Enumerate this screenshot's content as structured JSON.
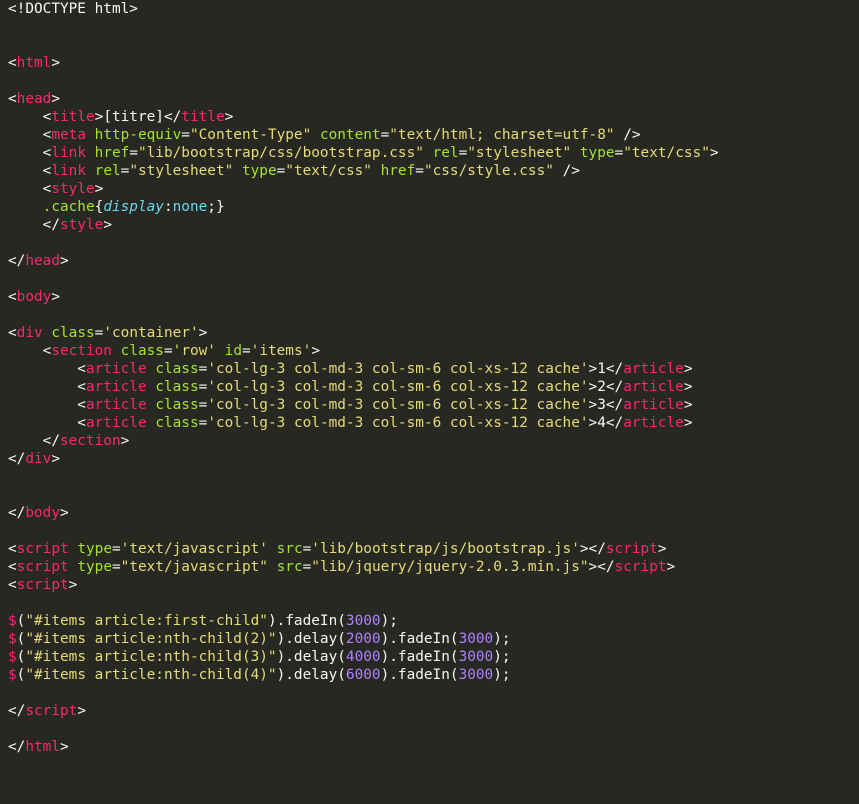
{
  "editor": {
    "theme": {
      "background": "#272822",
      "plain": "#f8f8f2",
      "tag": "#f92672",
      "attribute": "#a6e22e",
      "string": "#e6db74",
      "number": "#ae81ff",
      "property": "#66d9ef"
    },
    "lines": [
      [
        {
          "t": "<!DOCTYPE html>",
          "c": "plain"
        }
      ],
      [],
      [],
      [
        {
          "t": "<",
          "c": "plain"
        },
        {
          "t": "html",
          "c": "tag"
        },
        {
          "t": ">",
          "c": "plain"
        }
      ],
      [],
      [
        {
          "t": "<",
          "c": "plain"
        },
        {
          "t": "head",
          "c": "tag"
        },
        {
          "t": ">",
          "c": "plain"
        }
      ],
      [
        {
          "t": "    <",
          "c": "plain"
        },
        {
          "t": "title",
          "c": "tag"
        },
        {
          "t": ">[titre]</",
          "c": "plain"
        },
        {
          "t": "title",
          "c": "tag"
        },
        {
          "t": ">",
          "c": "plain"
        }
      ],
      [
        {
          "t": "    <",
          "c": "plain"
        },
        {
          "t": "meta",
          "c": "tag"
        },
        {
          "t": " ",
          "c": "plain"
        },
        {
          "t": "http-equiv",
          "c": "attr"
        },
        {
          "t": "=",
          "c": "plain"
        },
        {
          "t": "\"Content-Type\"",
          "c": "str"
        },
        {
          "t": " ",
          "c": "plain"
        },
        {
          "t": "content",
          "c": "attr"
        },
        {
          "t": "=",
          "c": "plain"
        },
        {
          "t": "\"text/html; charset=utf-8\"",
          "c": "str"
        },
        {
          "t": " />",
          "c": "plain"
        }
      ],
      [
        {
          "t": "    <",
          "c": "plain"
        },
        {
          "t": "link",
          "c": "tag"
        },
        {
          "t": " ",
          "c": "plain"
        },
        {
          "t": "href",
          "c": "attr"
        },
        {
          "t": "=",
          "c": "plain"
        },
        {
          "t": "\"lib/bootstrap/css/bootstrap.css\"",
          "c": "str"
        },
        {
          "t": " ",
          "c": "plain"
        },
        {
          "t": "rel",
          "c": "attr"
        },
        {
          "t": "=",
          "c": "plain"
        },
        {
          "t": "\"stylesheet\"",
          "c": "str"
        },
        {
          "t": " ",
          "c": "plain"
        },
        {
          "t": "type",
          "c": "attr"
        },
        {
          "t": "=",
          "c": "plain"
        },
        {
          "t": "\"text/css\"",
          "c": "str"
        },
        {
          "t": ">",
          "c": "plain"
        }
      ],
      [
        {
          "t": "    <",
          "c": "plain"
        },
        {
          "t": "link",
          "c": "tag"
        },
        {
          "t": " ",
          "c": "plain"
        },
        {
          "t": "rel",
          "c": "attr"
        },
        {
          "t": "=",
          "c": "plain"
        },
        {
          "t": "\"stylesheet\"",
          "c": "str"
        },
        {
          "t": " ",
          "c": "plain"
        },
        {
          "t": "type",
          "c": "attr"
        },
        {
          "t": "=",
          "c": "plain"
        },
        {
          "t": "\"text/css\"",
          "c": "str"
        },
        {
          "t": " ",
          "c": "plain"
        },
        {
          "t": "href",
          "c": "attr"
        },
        {
          "t": "=",
          "c": "plain"
        },
        {
          "t": "\"css/style.css\"",
          "c": "str"
        },
        {
          "t": " />",
          "c": "plain"
        }
      ],
      [
        {
          "t": "    <",
          "c": "plain"
        },
        {
          "t": "style",
          "c": "tag"
        },
        {
          "t": ">",
          "c": "plain"
        }
      ],
      [
        {
          "t": "    ",
          "c": "plain"
        },
        {
          "t": ".cache",
          "c": "sel"
        },
        {
          "t": "{",
          "c": "plain"
        },
        {
          "t": "display",
          "c": "prop"
        },
        {
          "t": ":",
          "c": "plain"
        },
        {
          "t": "none",
          "c": "val"
        },
        {
          "t": ";}",
          "c": "plain"
        }
      ],
      [
        {
          "t": "    </",
          "c": "plain"
        },
        {
          "t": "style",
          "c": "tag"
        },
        {
          "t": ">",
          "c": "plain"
        }
      ],
      [],
      [
        {
          "t": "</",
          "c": "plain"
        },
        {
          "t": "head",
          "c": "tag"
        },
        {
          "t": ">",
          "c": "plain"
        }
      ],
      [],
      [
        {
          "t": "<",
          "c": "plain"
        },
        {
          "t": "body",
          "c": "tag"
        },
        {
          "t": ">",
          "c": "plain"
        }
      ],
      [],
      [
        {
          "t": "<",
          "c": "plain"
        },
        {
          "t": "div",
          "c": "tag"
        },
        {
          "t": " ",
          "c": "plain"
        },
        {
          "t": "class",
          "c": "attr"
        },
        {
          "t": "=",
          "c": "plain"
        },
        {
          "t": "'container'",
          "c": "str"
        },
        {
          "t": ">",
          "c": "plain"
        }
      ],
      [
        {
          "t": "    <",
          "c": "plain"
        },
        {
          "t": "section",
          "c": "tag"
        },
        {
          "t": " ",
          "c": "plain"
        },
        {
          "t": "class",
          "c": "attr"
        },
        {
          "t": "=",
          "c": "plain"
        },
        {
          "t": "'row'",
          "c": "str"
        },
        {
          "t": " ",
          "c": "plain"
        },
        {
          "t": "id",
          "c": "attr"
        },
        {
          "t": "=",
          "c": "plain"
        },
        {
          "t": "'items'",
          "c": "str"
        },
        {
          "t": ">",
          "c": "plain"
        }
      ],
      [
        {
          "t": "        <",
          "c": "plain"
        },
        {
          "t": "article",
          "c": "tag"
        },
        {
          "t": " ",
          "c": "plain"
        },
        {
          "t": "class",
          "c": "attr"
        },
        {
          "t": "=",
          "c": "plain"
        },
        {
          "t": "'col-lg-3 col-md-3 col-sm-6 col-xs-12 cache'",
          "c": "str"
        },
        {
          "t": ">1</",
          "c": "plain"
        },
        {
          "t": "article",
          "c": "tag"
        },
        {
          "t": ">",
          "c": "plain"
        }
      ],
      [
        {
          "t": "        <",
          "c": "plain"
        },
        {
          "t": "article",
          "c": "tag"
        },
        {
          "t": " ",
          "c": "plain"
        },
        {
          "t": "class",
          "c": "attr"
        },
        {
          "t": "=",
          "c": "plain"
        },
        {
          "t": "'col-lg-3 col-md-3 col-sm-6 col-xs-12 cache'",
          "c": "str"
        },
        {
          "t": ">2</",
          "c": "plain"
        },
        {
          "t": "article",
          "c": "tag"
        },
        {
          "t": ">",
          "c": "plain"
        }
      ],
      [
        {
          "t": "        <",
          "c": "plain"
        },
        {
          "t": "article",
          "c": "tag"
        },
        {
          "t": " ",
          "c": "plain"
        },
        {
          "t": "class",
          "c": "attr"
        },
        {
          "t": "=",
          "c": "plain"
        },
        {
          "t": "'col-lg-3 col-md-3 col-sm-6 col-xs-12 cache'",
          "c": "str"
        },
        {
          "t": ">3</",
          "c": "plain"
        },
        {
          "t": "article",
          "c": "tag"
        },
        {
          "t": ">",
          "c": "plain"
        }
      ],
      [
        {
          "t": "        <",
          "c": "plain"
        },
        {
          "t": "article",
          "c": "tag"
        },
        {
          "t": " ",
          "c": "plain"
        },
        {
          "t": "class",
          "c": "attr"
        },
        {
          "t": "=",
          "c": "plain"
        },
        {
          "t": "'col-lg-3 col-md-3 col-sm-6 col-xs-12 cache'",
          "c": "str"
        },
        {
          "t": ">4</",
          "c": "plain"
        },
        {
          "t": "article",
          "c": "tag"
        },
        {
          "t": ">",
          "c": "plain"
        }
      ],
      [
        {
          "t": "    </",
          "c": "plain"
        },
        {
          "t": "section",
          "c": "tag"
        },
        {
          "t": ">",
          "c": "plain"
        }
      ],
      [
        {
          "t": "</",
          "c": "plain"
        },
        {
          "t": "div",
          "c": "tag"
        },
        {
          "t": ">",
          "c": "plain"
        }
      ],
      [],
      [],
      [
        {
          "t": "</",
          "c": "plain"
        },
        {
          "t": "body",
          "c": "tag"
        },
        {
          "t": ">",
          "c": "plain"
        }
      ],
      [],
      [
        {
          "t": "<",
          "c": "plain"
        },
        {
          "t": "script",
          "c": "tag"
        },
        {
          "t": " ",
          "c": "plain"
        },
        {
          "t": "type",
          "c": "attr"
        },
        {
          "t": "=",
          "c": "plain"
        },
        {
          "t": "'text/javascript'",
          "c": "str"
        },
        {
          "t": " ",
          "c": "plain"
        },
        {
          "t": "src",
          "c": "attr"
        },
        {
          "t": "=",
          "c": "plain"
        },
        {
          "t": "'lib/bootstrap/js/bootstrap.js'",
          "c": "str"
        },
        {
          "t": "></",
          "c": "plain"
        },
        {
          "t": "script",
          "c": "tag"
        },
        {
          "t": ">",
          "c": "plain"
        }
      ],
      [
        {
          "t": "<",
          "c": "plain"
        },
        {
          "t": "script",
          "c": "tag"
        },
        {
          "t": " ",
          "c": "plain"
        },
        {
          "t": "type",
          "c": "attr"
        },
        {
          "t": "=",
          "c": "plain"
        },
        {
          "t": "\"text/javascript\"",
          "c": "str"
        },
        {
          "t": " ",
          "c": "plain"
        },
        {
          "t": "src",
          "c": "attr"
        },
        {
          "t": "=",
          "c": "plain"
        },
        {
          "t": "\"lib/jquery/jquery-2.0.3.min.js\"",
          "c": "str"
        },
        {
          "t": "></",
          "c": "plain"
        },
        {
          "t": "script",
          "c": "tag"
        },
        {
          "t": ">",
          "c": "plain"
        }
      ],
      [
        {
          "t": "<",
          "c": "plain"
        },
        {
          "t": "script",
          "c": "tag"
        },
        {
          "t": ">",
          "c": "plain"
        }
      ],
      [],
      [
        {
          "t": "$",
          "c": "fn"
        },
        {
          "t": "(",
          "c": "plain"
        },
        {
          "t": "\"#items article:first-child\"",
          "c": "str"
        },
        {
          "t": ").fadeIn(",
          "c": "plain"
        },
        {
          "t": "3000",
          "c": "num"
        },
        {
          "t": ");",
          "c": "plain"
        }
      ],
      [
        {
          "t": "$",
          "c": "fn"
        },
        {
          "t": "(",
          "c": "plain"
        },
        {
          "t": "\"#items article:nth-child(2)\"",
          "c": "str"
        },
        {
          "t": ").delay(",
          "c": "plain"
        },
        {
          "t": "2000",
          "c": "num"
        },
        {
          "t": ").fadeIn(",
          "c": "plain"
        },
        {
          "t": "3000",
          "c": "num"
        },
        {
          "t": ");",
          "c": "plain"
        }
      ],
      [
        {
          "t": "$",
          "c": "fn"
        },
        {
          "t": "(",
          "c": "plain"
        },
        {
          "t": "\"#items article:nth-child(3)\"",
          "c": "str"
        },
        {
          "t": ").delay(",
          "c": "plain"
        },
        {
          "t": "4000",
          "c": "num"
        },
        {
          "t": ").fadeIn(",
          "c": "plain"
        },
        {
          "t": "3000",
          "c": "num"
        },
        {
          "t": ");",
          "c": "plain"
        }
      ],
      [
        {
          "t": "$",
          "c": "fn"
        },
        {
          "t": "(",
          "c": "plain"
        },
        {
          "t": "\"#items article:nth-child(4)\"",
          "c": "str"
        },
        {
          "t": ").delay(",
          "c": "plain"
        },
        {
          "t": "6000",
          "c": "num"
        },
        {
          "t": ").fadeIn(",
          "c": "plain"
        },
        {
          "t": "3000",
          "c": "num"
        },
        {
          "t": ");",
          "c": "plain"
        }
      ],
      [],
      [
        {
          "t": "</",
          "c": "plain"
        },
        {
          "t": "script",
          "c": "tag"
        },
        {
          "t": ">",
          "c": "plain"
        }
      ],
      [],
      [
        {
          "t": "</",
          "c": "plain"
        },
        {
          "t": "html",
          "c": "tag"
        },
        {
          "t": ">",
          "c": "plain"
        }
      ]
    ]
  }
}
